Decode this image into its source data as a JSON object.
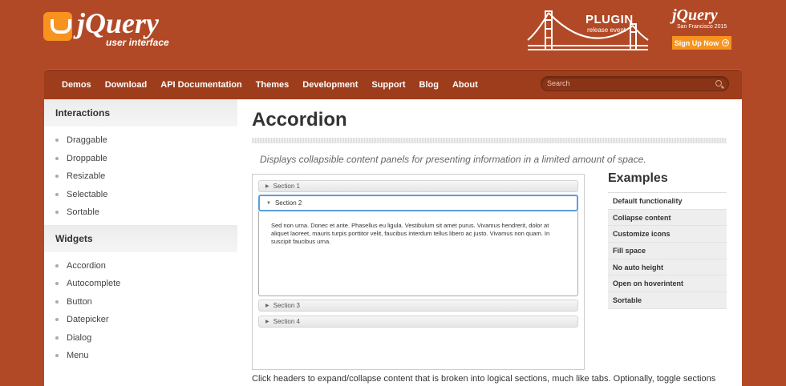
{
  "brand": {
    "logo_main": "jQuery",
    "logo_sub": "user interface"
  },
  "promo": {
    "plugin_title": "PLUGIN",
    "plugin_sub": "release event",
    "event_logo": "jQuery",
    "event_location": "San Francisco 2015",
    "signup_label": "Sign Up Now"
  },
  "nav": {
    "items": [
      "Demos",
      "Download",
      "API Documentation",
      "Themes",
      "Development",
      "Support",
      "Blog",
      "About"
    ],
    "search_placeholder": "Search"
  },
  "sidebar": {
    "sections": [
      {
        "title": "Interactions",
        "items": [
          "Draggable",
          "Droppable",
          "Resizable",
          "Selectable",
          "Sortable"
        ]
      },
      {
        "title": "Widgets",
        "items": [
          "Accordion",
          "Autocomplete",
          "Button",
          "Datepicker",
          "Dialog",
          "Menu"
        ]
      }
    ]
  },
  "main": {
    "title": "Accordion",
    "description": "Displays collapsible content panels for presenting information in a limited amount of space.",
    "accordion": {
      "sections": [
        "Section 1",
        "Section 2",
        "Section 3",
        "Section 4"
      ],
      "active_body": "Sed non urna. Donec et ante. Phasellus eu ligula. Vestibulum sit amet purus. Vivamus hendrerit, dolor at aliquet laoreet, mauris turpis porttitor velit, faucibus interdum tellus libero ac justo. Vivamus non quam. In suscipit faucibus urna."
    },
    "bottom_text": "Click headers to expand/collapse content that is broken into logical sections, much like tabs. Optionally, toggle sections"
  },
  "examples": {
    "title": "Examples",
    "items": [
      "Default functionality",
      "Collapse content",
      "Customize icons",
      "Fill space",
      "No auto height",
      "Open on hoverintent",
      "Sortable"
    ]
  }
}
